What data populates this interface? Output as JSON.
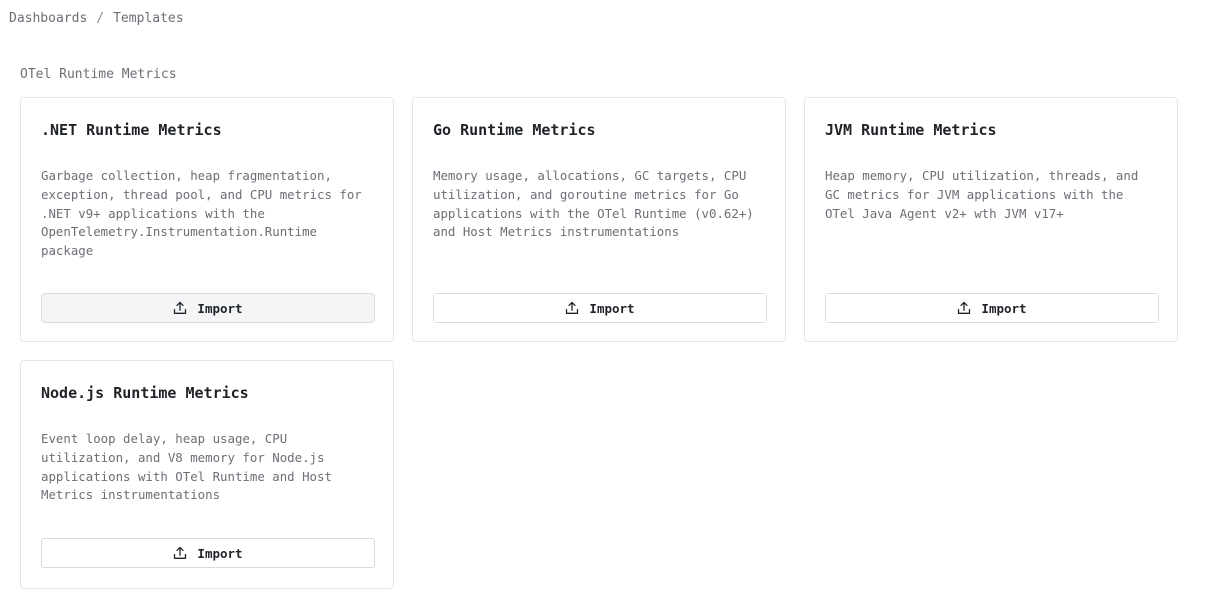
{
  "breadcrumb": {
    "items": [
      "Dashboards",
      "Templates"
    ],
    "separator": "/"
  },
  "section": {
    "title": "OTel Runtime Metrics"
  },
  "cards": [
    {
      "title": ".NET Runtime Metrics",
      "description": "Garbage collection, heap fragmentation, exception, thread pool, and CPU metrics for .NET v9+ applications with the OpenTelemetry.Instrumentation.Runtime package",
      "button_label": "Import",
      "button_icon": "upload-icon",
      "hovered": true
    },
    {
      "title": "Go Runtime Metrics",
      "description": "Memory usage, allocations, GC targets, CPU utilization, and goroutine metrics for Go applications with the OTel Runtime (v0.62+) and Host Metrics instrumentations",
      "button_label": "Import",
      "button_icon": "upload-icon",
      "hovered": false
    },
    {
      "title": "JVM Runtime Metrics",
      "description": "Heap memory, CPU utilization, threads, and GC metrics for JVM applications with the OTel Java Agent v2+ wth JVM v17+",
      "button_label": "Import",
      "button_icon": "upload-icon",
      "hovered": false
    },
    {
      "title": "Node.js Runtime Metrics",
      "description": "Event loop delay, heap usage, CPU utilization, and V8 memory for Node.js applications with OTel Runtime and Host Metrics instrumentations",
      "button_label": "Import",
      "button_icon": "upload-icon",
      "hovered": false
    }
  ]
}
